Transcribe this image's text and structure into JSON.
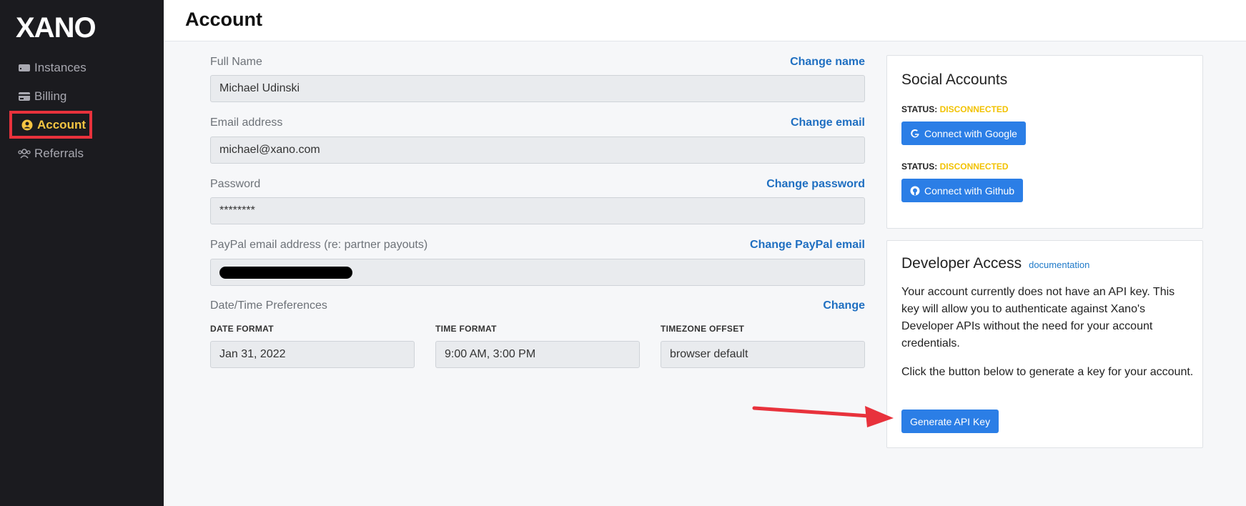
{
  "app": {
    "logo_text": "XANO"
  },
  "sidebar": {
    "items": [
      {
        "label": "Instances",
        "icon": "server-icon"
      },
      {
        "label": "Billing",
        "icon": "credit-card-icon"
      },
      {
        "label": "Account",
        "icon": "user-circle-icon",
        "active": true
      },
      {
        "label": "Referrals",
        "icon": "users-icon"
      }
    ]
  },
  "header": {
    "title": "Account"
  },
  "form": {
    "full_name": {
      "label": "Full Name",
      "change_label": "Change name",
      "value": "Michael Udinski"
    },
    "email": {
      "label": "Email address",
      "change_label": "Change email",
      "value": "michael@xano.com"
    },
    "password": {
      "label": "Password",
      "change_label": "Change password",
      "value": "********"
    },
    "paypal": {
      "label": "PayPal email address (re: partner payouts)",
      "change_label": "Change PayPal email"
    },
    "datetime": {
      "label": "Date/Time Preferences",
      "change_label": "Change",
      "date_format": {
        "label": "DATE FORMAT",
        "value": "Jan 31, 2022"
      },
      "time_format": {
        "label": "TIME FORMAT",
        "value": "9:00 AM, 3:00 PM"
      },
      "timezone": {
        "label": "TIMEZONE OFFSET",
        "value": "browser default"
      }
    }
  },
  "social": {
    "title": "Social Accounts",
    "status_prefix": "STATUS: ",
    "google": {
      "status": "DISCONNECTED",
      "button": "Connect with Google"
    },
    "github": {
      "status": "DISCONNECTED",
      "button": "Connect with Github"
    }
  },
  "developer": {
    "title": "Developer Access",
    "doc_link": "documentation",
    "desc1": "Your account currently does not have an API key. This key will allow you to authenticate against Xano's Developer APIs without the need for your account credentials.",
    "desc2": "Click the button below to generate a key for your account.",
    "button": "Generate API Key"
  },
  "colors": {
    "accent": "#2b7ee6",
    "link": "#1f6fc1",
    "warning": "#f2c200",
    "highlight": "#e8323c",
    "sidebar_bg": "#1b1b1f"
  }
}
